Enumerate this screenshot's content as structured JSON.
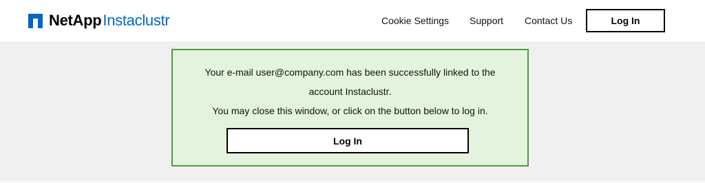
{
  "header": {
    "logo": {
      "brand_primary": "NetApp",
      "brand_secondary": "Instaclustr",
      "mark_icon": "netapp-square-logo-icon",
      "mark_color": "#0067c5",
      "secondary_color": "#0067c5"
    },
    "nav": {
      "cookie_settings": "Cookie Settings",
      "support": "Support",
      "contact_us": "Contact Us",
      "login": "Log In"
    }
  },
  "notice": {
    "line1": "Your e-mail user@company.com has been successfully linked to the",
    "line2": "account Instaclustr.",
    "line3": "You may close this window, or click on the button below to log in.",
    "login_button": "Log In",
    "background_color": "#e4f3dd",
    "border_color": "#4e9a3c"
  }
}
